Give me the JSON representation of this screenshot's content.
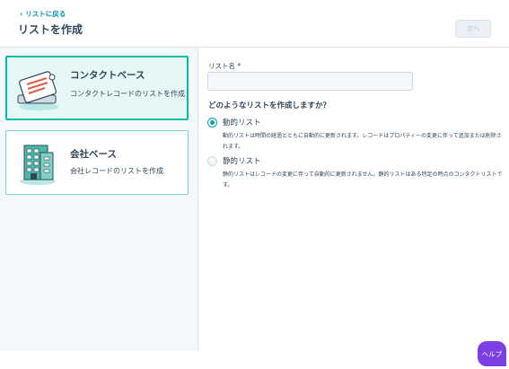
{
  "header": {
    "back_label": "リストに戻る",
    "title": "リストを作成",
    "next_label": "次へ"
  },
  "cards": {
    "contact": {
      "title": "コンタクトベース",
      "description": "コンタクトレコードのリストを作成",
      "icon": "contact-card-icon"
    },
    "company": {
      "title": "会社ベース",
      "description": "会社レコードのリストを作成",
      "icon": "building-icon"
    }
  },
  "form": {
    "list_name_label": "リスト名 *",
    "list_name_value": "",
    "question": "どのようなリストを作成しますか？",
    "options": [
      {
        "label": "動的リスト",
        "description": "動的リストは時間の経過とともに自動的に更新されます。レコードはプロパティーの変更に伴って追加または削除されます。",
        "checked": true
      },
      {
        "label": "静的リスト",
        "description": "静的リストはレコードの変更に伴って自動的に更新されません。静的リストはある特定の時点のコンタクトリストです。",
        "checked": false
      }
    ]
  },
  "help": {
    "label": "ヘルプ"
  },
  "colors": {
    "accent": "#00bda5",
    "link": "#0091ae",
    "radio": "#00a4bd",
    "help": "#7b3fe4"
  }
}
